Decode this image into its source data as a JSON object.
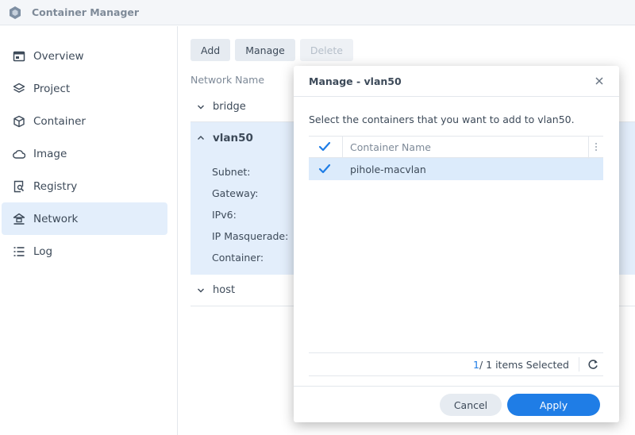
{
  "app": {
    "title": "Container Manager",
    "accent": "#1f7de6"
  },
  "sidebar": {
    "items": [
      {
        "label": "Overview",
        "icon": "overview-icon"
      },
      {
        "label": "Project",
        "icon": "project-icon"
      },
      {
        "label": "Container",
        "icon": "container-icon"
      },
      {
        "label": "Image",
        "icon": "cloud-icon"
      },
      {
        "label": "Registry",
        "icon": "registry-icon"
      },
      {
        "label": "Network",
        "icon": "network-icon",
        "active": true
      },
      {
        "label": "Log",
        "icon": "log-icon"
      }
    ]
  },
  "toolbar": {
    "add_label": "Add",
    "manage_label": "Manage",
    "delete_label": "Delete"
  },
  "network_list": {
    "column_header": "Network Name",
    "networks": [
      {
        "name": "bridge",
        "expanded": false
      },
      {
        "name": "vlan50",
        "expanded": true,
        "details": [
          "Subnet:",
          "Gateway:",
          "IPv6:",
          "IP Masquerade:",
          "Container:"
        ]
      },
      {
        "name": "host",
        "expanded": false
      }
    ]
  },
  "dialog": {
    "title": "Manage - vlan50",
    "instruction": "Select the containers that you want to add to vlan50.",
    "grid": {
      "column": "Container Name",
      "rows": [
        {
          "name": "pihole-macvlan",
          "checked": true
        }
      ]
    },
    "selection": {
      "selected": "1",
      "suffix": " / 1 items Selected"
    },
    "cancel_label": "Cancel",
    "apply_label": "Apply"
  }
}
